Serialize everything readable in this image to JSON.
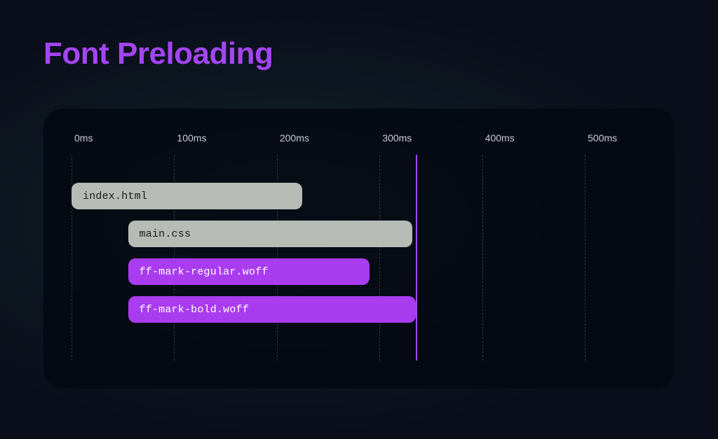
{
  "title": "Font Preloading",
  "chart_data": {
    "type": "bar",
    "orientation": "horizontal-timeline",
    "xlabel": "",
    "ylabel": "",
    "x_unit": "ms",
    "x_ticks": [
      0,
      100,
      200,
      300,
      400,
      500
    ],
    "tick_labels": [
      "0ms",
      "100ms",
      "200ms",
      "300ms",
      "400ms",
      "500ms"
    ],
    "marker_at": 335,
    "series": [
      {
        "name": "index.html",
        "start": 0,
        "end": 225,
        "color": "gray"
      },
      {
        "name": "main.css",
        "start": 55,
        "end": 332,
        "color": "gray"
      },
      {
        "name": "ff-mark-regular.woff",
        "start": 55,
        "end": 290,
        "color": "purple"
      },
      {
        "name": "ff-mark-bold.woff",
        "start": 55,
        "end": 335,
        "color": "purple"
      }
    ],
    "colors": {
      "gray": "#b6bbb6",
      "purple": "#a93cef",
      "accent": "#a445f2"
    }
  }
}
